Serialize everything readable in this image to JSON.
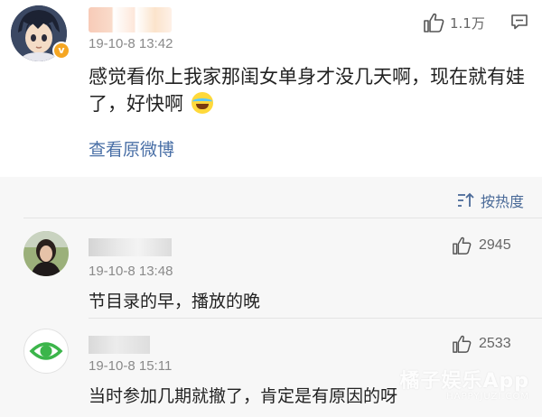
{
  "post": {
    "timestamp": "19-10-8 13:42",
    "like_count": "1.1万",
    "text": "感觉看你上我家那闺女单身才没几天啊，现在就有娃了，好快啊",
    "view_original_label": "查看原微博",
    "verified_badge": "v"
  },
  "comments_section": {
    "sort_label": "按热度",
    "items": [
      {
        "timestamp": "19-10-8 13:48",
        "like_count": "2945",
        "text": "节目录的早，播放的晚"
      },
      {
        "timestamp": "19-10-8 15:11",
        "like_count": "2533",
        "text": "当时参加几期就撤了，肯定是有原因的呀"
      }
    ]
  },
  "watermark": {
    "main": "橘子娱乐App",
    "sub": "HAPPYJUZI.COM"
  },
  "colors": {
    "link": "#496fa6",
    "badge": "#f5a623",
    "eye": "#3bb54a"
  }
}
